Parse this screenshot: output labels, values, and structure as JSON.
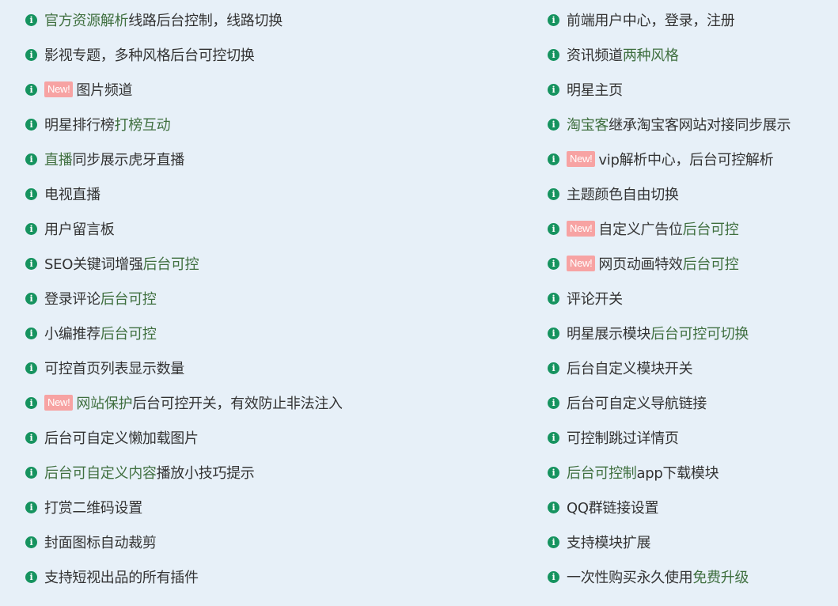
{
  "colors": {
    "background": "#e7f0f8",
    "text": "#333333",
    "highlight_text": "#3f6f3f",
    "icon": "#16935f",
    "badge": "#f7a3a3"
  },
  "icon_name": "info-circle-icon",
  "badge_label": "New!",
  "left_items": [
    {
      "badge": false,
      "segments": [
        {
          "text": "官方资源解析",
          "hl": true
        },
        {
          "text": "线路后台控制，线路切换",
          "hl": false
        }
      ]
    },
    {
      "badge": false,
      "segments": [
        {
          "text": "影视专题，多种风格后台可控切换",
          "hl": false
        }
      ]
    },
    {
      "badge": true,
      "segments": [
        {
          "text": "图片频道",
          "hl": false
        }
      ]
    },
    {
      "badge": false,
      "segments": [
        {
          "text": "明星排行榜",
          "hl": false
        },
        {
          "text": "打榜互动",
          "hl": true
        }
      ]
    },
    {
      "badge": false,
      "segments": [
        {
          "text": "直播",
          "hl": true
        },
        {
          "text": "同步展示虎牙直播",
          "hl": false
        }
      ]
    },
    {
      "badge": false,
      "segments": [
        {
          "text": "电视直播",
          "hl": false
        }
      ]
    },
    {
      "badge": false,
      "segments": [
        {
          "text": "用户留言板",
          "hl": false
        }
      ]
    },
    {
      "badge": false,
      "segments": [
        {
          "text": "SEO关键词增强",
          "hl": false
        },
        {
          "text": "后台可控",
          "hl": true
        }
      ]
    },
    {
      "badge": false,
      "segments": [
        {
          "text": "登录评论",
          "hl": false
        },
        {
          "text": "后台可控",
          "hl": true
        }
      ]
    },
    {
      "badge": false,
      "segments": [
        {
          "text": "小编推荐",
          "hl": false
        },
        {
          "text": "后台可控",
          "hl": true
        }
      ]
    },
    {
      "badge": false,
      "segments": [
        {
          "text": "可控首页列表显示数量",
          "hl": false
        }
      ]
    },
    {
      "badge": true,
      "segments": [
        {
          "text": "网站保护",
          "hl": true
        },
        {
          "text": "后台可控开关，有效防止非法注入",
          "hl": false
        }
      ]
    },
    {
      "badge": false,
      "segments": [
        {
          "text": "后台可自定义懒加载图片",
          "hl": false
        }
      ]
    },
    {
      "badge": false,
      "segments": [
        {
          "text": "后台可自定义内容",
          "hl": true
        },
        {
          "text": "播放小技巧提示",
          "hl": false
        }
      ]
    },
    {
      "badge": false,
      "segments": [
        {
          "text": "打赏二维码设置",
          "hl": false
        }
      ]
    },
    {
      "badge": false,
      "segments": [
        {
          "text": "封面图标自动裁剪",
          "hl": false
        }
      ]
    },
    {
      "badge": false,
      "segments": [
        {
          "text": "支持短视出品的所有插件",
          "hl": false
        }
      ]
    }
  ],
  "right_items": [
    {
      "badge": false,
      "segments": [
        {
          "text": "前端用户中心，登录，注册",
          "hl": false
        }
      ]
    },
    {
      "badge": false,
      "segments": [
        {
          "text": "资讯频道",
          "hl": false
        },
        {
          "text": "两种风格",
          "hl": true
        }
      ]
    },
    {
      "badge": false,
      "segments": [
        {
          "text": "明星主页",
          "hl": false
        }
      ]
    },
    {
      "badge": false,
      "segments": [
        {
          "text": "淘宝客",
          "hl": true
        },
        {
          "text": "继承淘宝客网站对接同步展示",
          "hl": false
        }
      ]
    },
    {
      "badge": true,
      "segments": [
        {
          "text": "vip解析中心，后台可控解析",
          "hl": false
        }
      ]
    },
    {
      "badge": false,
      "segments": [
        {
          "text": "主题颜色自由切换",
          "hl": false
        }
      ]
    },
    {
      "badge": true,
      "segments": [
        {
          "text": "自定义广告位",
          "hl": false
        },
        {
          "text": "后台可控",
          "hl": true
        }
      ]
    },
    {
      "badge": true,
      "segments": [
        {
          "text": "网页动画特效",
          "hl": false
        },
        {
          "text": "后台可控",
          "hl": true
        }
      ]
    },
    {
      "badge": false,
      "segments": [
        {
          "text": "评论开关",
          "hl": false
        }
      ]
    },
    {
      "badge": false,
      "segments": [
        {
          "text": "明星展示模块",
          "hl": false
        },
        {
          "text": "后台可控可切换",
          "hl": true
        }
      ]
    },
    {
      "badge": false,
      "segments": [
        {
          "text": "后台自定义模块开关",
          "hl": false
        }
      ]
    },
    {
      "badge": false,
      "segments": [
        {
          "text": "后台可自定义导航链接",
          "hl": false
        }
      ]
    },
    {
      "badge": false,
      "segments": [
        {
          "text": "可控制跳过详情页",
          "hl": false
        }
      ]
    },
    {
      "badge": false,
      "segments": [
        {
          "text": "后台可控制",
          "hl": true
        },
        {
          "text": "app下载模块",
          "hl": false
        }
      ]
    },
    {
      "badge": false,
      "segments": [
        {
          "text": "QQ群链接设置",
          "hl": false
        }
      ]
    },
    {
      "badge": false,
      "segments": [
        {
          "text": "支持模块扩展",
          "hl": false
        }
      ]
    },
    {
      "badge": false,
      "segments": [
        {
          "text": "一次性购买永久使用",
          "hl": false
        },
        {
          "text": "免费升级",
          "hl": true
        }
      ]
    }
  ]
}
